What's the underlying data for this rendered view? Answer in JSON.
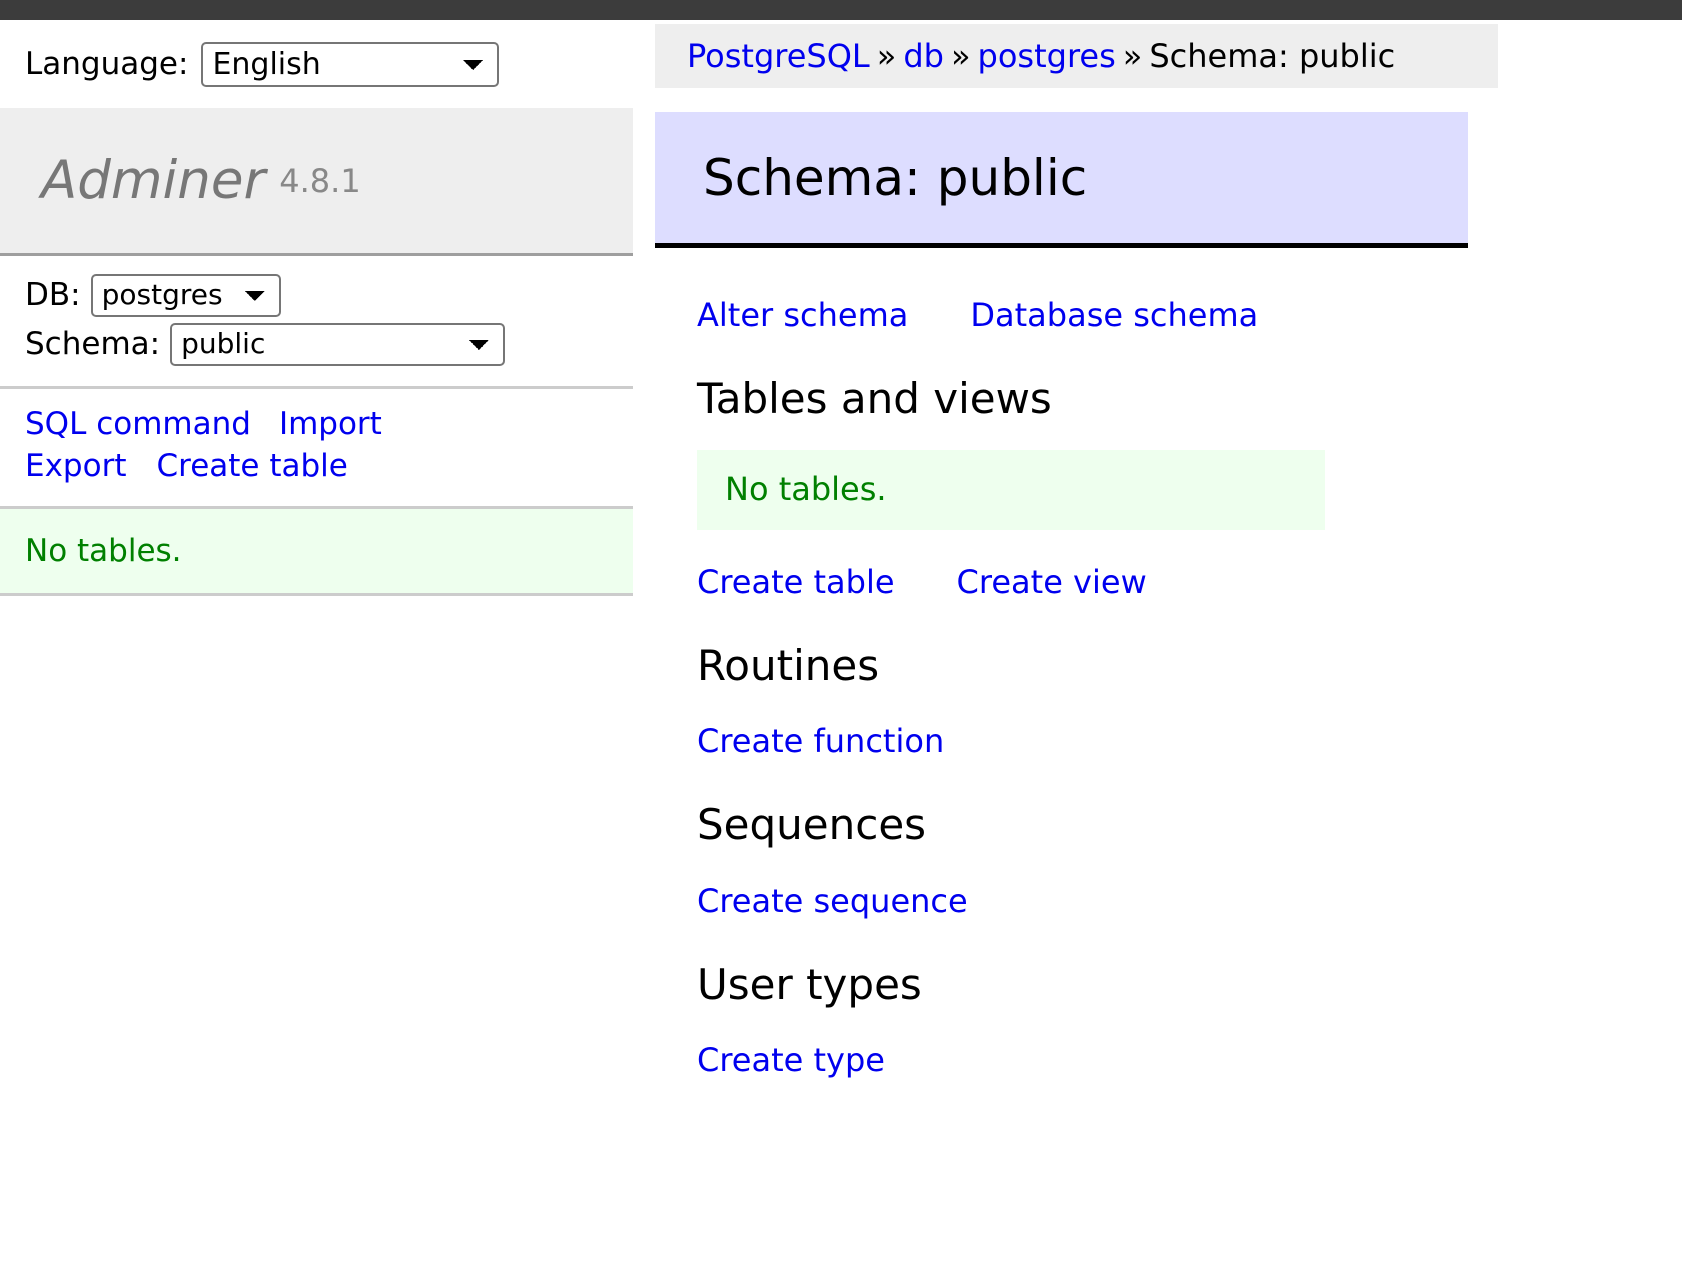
{
  "topbar": {
    "color": "#3c3c3c"
  },
  "language": {
    "label": "Language:",
    "selected": "English"
  },
  "breadcrumb": {
    "server": "PostgreSQL",
    "sep1": "»",
    "host": "db",
    "sep2": "»",
    "database": "postgres",
    "sep3": "»",
    "current": "Schema: public"
  },
  "sidebar": {
    "logo": "Adminer",
    "version": "4.8.1",
    "db_label": "DB:",
    "db_selected": "postgres",
    "schema_label": "Schema:",
    "schema_selected": "public",
    "links": [
      {
        "label": "SQL command"
      },
      {
        "label": "Import"
      },
      {
        "label": "Export"
      },
      {
        "label": "Create table"
      }
    ],
    "message": "No tables."
  },
  "main": {
    "heading": "Schema: public",
    "top_links": [
      {
        "label": "Alter schema"
      },
      {
        "label": "Database schema"
      }
    ],
    "sections": [
      {
        "title": "Tables and views",
        "message": "No tables.",
        "links": [
          {
            "label": "Create table"
          },
          {
            "label": "Create view"
          }
        ]
      },
      {
        "title": "Routines",
        "links": [
          {
            "label": "Create function"
          }
        ]
      },
      {
        "title": "Sequences",
        "links": [
          {
            "label": "Create sequence"
          }
        ]
      },
      {
        "title": "User types",
        "links": [
          {
            "label": "Create type"
          }
        ]
      }
    ]
  },
  "colors": {
    "link": "#0000ee",
    "heading_bg": "#ddddff",
    "message_bg": "#eeffee",
    "message_text": "#008000",
    "panel_bg": "#eeeeee"
  }
}
